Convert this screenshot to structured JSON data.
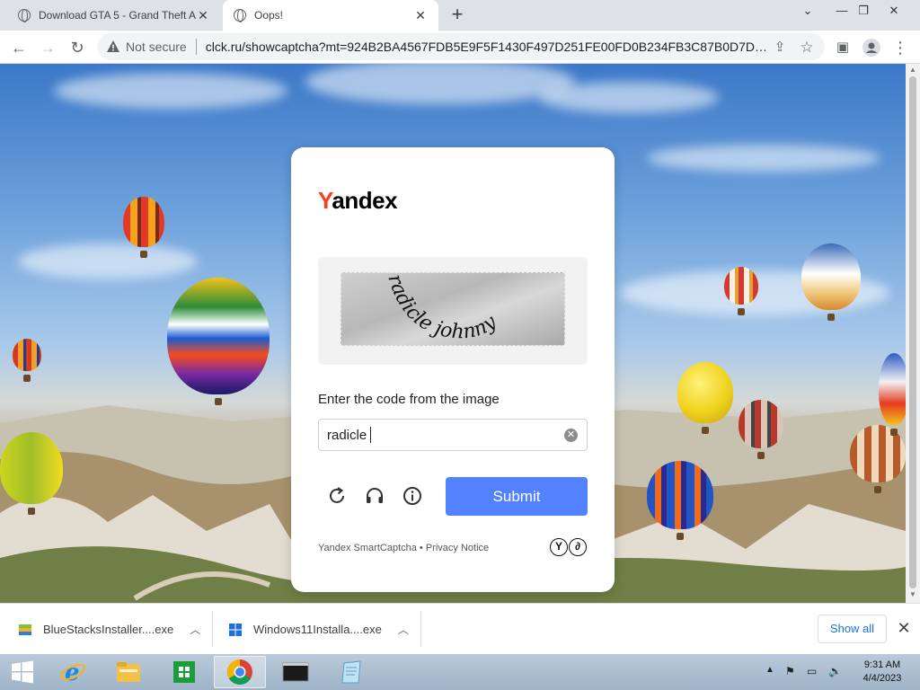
{
  "browser": {
    "tabs": [
      {
        "title": "Download GTA 5 - Grand Theft A",
        "active": false
      },
      {
        "title": "Oops!",
        "active": true
      }
    ],
    "new_tab_label": "+",
    "security_label": "Not secure",
    "url": "clck.ru/showcaptcha?mt=924B2BA4567FDB5E9F5F1430F497D251FE00FD0B234FB3C87B0D7D43E7..."
  },
  "captcha": {
    "logo_first": "Y",
    "logo_rest": "andex",
    "image_text": "radicle johnny",
    "prompt": "Enter the code from the image",
    "input_value": "radicle",
    "submit_label": "Submit",
    "footer_brand": "Yandex SmartCaptcha",
    "footer_dot": " • ",
    "footer_privacy": "Privacy Notice",
    "badge_1": "Y",
    "badge_2": "∂"
  },
  "downloads": {
    "items": [
      {
        "name": "BlueStacksInstaller....exe"
      },
      {
        "name": "Windows11Installa....exe"
      }
    ],
    "show_all": "Show all"
  },
  "taskbar": {
    "time": "9:31 AM",
    "date": "4/4/2023"
  },
  "colors": {
    "yandex_red": "#fc3f1d",
    "submit_blue": "#5282ff",
    "link_blue": "#1a73e8"
  }
}
